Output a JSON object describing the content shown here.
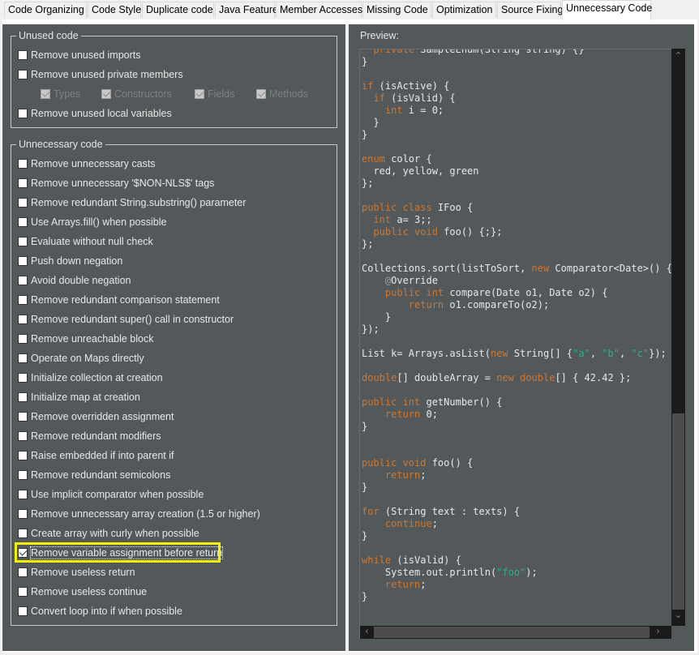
{
  "tabs": [
    {
      "label": "Code Organizing",
      "active": false
    },
    {
      "label": "Code Style",
      "active": false
    },
    {
      "label": "Duplicate code",
      "active": false
    },
    {
      "label": "Java Feature",
      "active": false
    },
    {
      "label": "Member Accesses",
      "active": false
    },
    {
      "label": "Missing Code",
      "active": false
    },
    {
      "label": "Optimization",
      "active": false
    },
    {
      "label": "Source Fixing",
      "active": false
    },
    {
      "label": "Unnecessary Code",
      "active": true
    }
  ],
  "unused_code": {
    "title": "Unused code",
    "options": [
      {
        "label": "Remove unused imports",
        "checked": false
      },
      {
        "label": "Remove unused private members",
        "checked": false
      },
      {
        "label": "Remove unused local variables",
        "checked": false
      }
    ],
    "members": [
      {
        "label": "Types",
        "checked": true,
        "enabled": false
      },
      {
        "label": "Constructors",
        "checked": true,
        "enabled": false
      },
      {
        "label": "Fields",
        "checked": true,
        "enabled": false
      },
      {
        "label": "Methods",
        "checked": true,
        "enabled": false
      }
    ]
  },
  "unnecessary_code": {
    "title": "Unnecessary code",
    "options": [
      {
        "label": "Remove unnecessary casts",
        "checked": false
      },
      {
        "label": "Remove unnecessary '$NON-NLS$' tags",
        "checked": false
      },
      {
        "label": "Remove redundant String.substring() parameter",
        "checked": false
      },
      {
        "label": "Use Arrays.fill() when possible",
        "checked": false
      },
      {
        "label": "Evaluate without null check",
        "checked": false
      },
      {
        "label": "Push down negation",
        "checked": false
      },
      {
        "label": "Avoid double negation",
        "checked": false
      },
      {
        "label": "Remove redundant comparison statement",
        "checked": false
      },
      {
        "label": "Remove redundant super() call in constructor",
        "checked": false
      },
      {
        "label": "Remove unreachable block",
        "checked": false
      },
      {
        "label": "Operate on Maps directly",
        "checked": false
      },
      {
        "label": "Initialize collection at creation",
        "checked": false
      },
      {
        "label": "Initialize map at creation",
        "checked": false
      },
      {
        "label": "Remove overridden assignment",
        "checked": false
      },
      {
        "label": "Remove redundant modifiers",
        "checked": false
      },
      {
        "label": "Raise embedded if into parent if",
        "checked": false
      },
      {
        "label": "Remove redundant semicolons",
        "checked": false
      },
      {
        "label": "Use implicit comparator when possible",
        "checked": false
      },
      {
        "label": "Remove unnecessary array creation (1.5 or higher)",
        "checked": false
      },
      {
        "label": "Create array with curly when possible",
        "checked": false
      },
      {
        "label": "Remove variable assignment before return",
        "checked": true,
        "focused": true
      },
      {
        "label": "Remove useless return",
        "checked": false
      },
      {
        "label": "Remove useless continue",
        "checked": false
      },
      {
        "label": "Convert loop into if when possible",
        "checked": false
      }
    ]
  },
  "preview": {
    "label": "Preview:",
    "code_lines": [
      [
        [
          "kw",
          "  private "
        ],
        [
          "",
          "SampleEnum(String string) {}"
        ]
      ],
      [
        [
          "",
          "}"
        ]
      ],
      [
        [
          "",
          ""
        ]
      ],
      [
        [
          "kw",
          "if"
        ],
        [
          "",
          " (isActive) {"
        ]
      ],
      [
        [
          "kw",
          "  if"
        ],
        [
          "",
          " (isValid) {"
        ]
      ],
      [
        [
          "kw",
          "    int"
        ],
        [
          "",
          " i = 0;"
        ]
      ],
      [
        [
          "",
          "  }"
        ]
      ],
      [
        [
          "",
          "}"
        ]
      ],
      [
        [
          "",
          ""
        ]
      ],
      [
        [
          "kw",
          "enum"
        ],
        [
          "",
          " color {"
        ]
      ],
      [
        [
          "",
          "  red, yellow, green"
        ]
      ],
      [
        [
          "",
          "};"
        ]
      ],
      [
        [
          "",
          ""
        ]
      ],
      [
        [
          "kw",
          "public class"
        ],
        [
          "",
          " IFoo {"
        ]
      ],
      [
        [
          "kw",
          "  int"
        ],
        [
          "",
          " a= 3;;"
        ]
      ],
      [
        [
          "kw",
          "  public void"
        ],
        [
          "",
          " foo() {;};"
        ]
      ],
      [
        [
          "",
          "};"
        ]
      ],
      [
        [
          "",
          ""
        ]
      ],
      [
        [
          "",
          "Collections.sort(listToSort, "
        ],
        [
          "kw",
          "new"
        ],
        [
          "",
          " Comparator<Date>() {"
        ]
      ],
      [
        [
          "ann",
          "    @"
        ],
        [
          "",
          "Override"
        ]
      ],
      [
        [
          "kw",
          "    public int"
        ],
        [
          "",
          " compare(Date o1, Date o2) {"
        ]
      ],
      [
        [
          "kw",
          "        return"
        ],
        [
          "",
          " o1.compareTo(o2);"
        ]
      ],
      [
        [
          "",
          "    }"
        ]
      ],
      [
        [
          "",
          "});"
        ]
      ],
      [
        [
          "",
          ""
        ]
      ],
      [
        [
          "",
          "List k= Arrays.asList("
        ],
        [
          "kw",
          "new"
        ],
        [
          "",
          " String[] {"
        ],
        [
          "str",
          "\"a\""
        ],
        [
          "",
          ", "
        ],
        [
          "str",
          "\"b\""
        ],
        [
          "",
          ", "
        ],
        [
          "str",
          "\"c\""
        ],
        [
          "",
          "});"
        ]
      ],
      [
        [
          "",
          ""
        ]
      ],
      [
        [
          "kw",
          "double"
        ],
        [
          "",
          "[] doubleArray = "
        ],
        [
          "kw",
          "new double"
        ],
        [
          "",
          "[] { 42.42 };"
        ]
      ],
      [
        [
          "",
          ""
        ]
      ],
      [
        [
          "kw",
          "public int"
        ],
        [
          "",
          " getNumber() {"
        ]
      ],
      [
        [
          "kw",
          "    return"
        ],
        [
          "",
          " 0;"
        ]
      ],
      [
        [
          "",
          "}"
        ]
      ],
      [
        [
          "",
          ""
        ]
      ],
      [
        [
          "",
          ""
        ]
      ],
      [
        [
          "kw",
          "public void"
        ],
        [
          "",
          " foo() {"
        ]
      ],
      [
        [
          "kw",
          "    return"
        ],
        [
          "",
          ";"
        ]
      ],
      [
        [
          "",
          "}"
        ]
      ],
      [
        [
          "",
          ""
        ]
      ],
      [
        [
          "kw",
          "for"
        ],
        [
          "",
          " (String text : texts) {"
        ]
      ],
      [
        [
          "kw",
          "    continue"
        ],
        [
          "",
          ";"
        ]
      ],
      [
        [
          "",
          "}"
        ]
      ],
      [
        [
          "",
          ""
        ]
      ],
      [
        [
          "kw",
          "while"
        ],
        [
          "",
          " (isValid) {"
        ]
      ],
      [
        [
          "",
          "    System.out.println("
        ],
        [
          "str",
          "\"foo\""
        ],
        [
          "",
          ");"
        ]
      ],
      [
        [
          "kw",
          "    return"
        ],
        [
          "",
          ";"
        ]
      ],
      [
        [
          "",
          "}"
        ]
      ]
    ],
    "vertical_scroll_position": 0.62,
    "horizontal_scroll_position": 0.0
  },
  "icons": {
    "scroll_up": "▲",
    "scroll_down": "▼",
    "scroll_left": "◀",
    "scroll_right": "▶"
  }
}
